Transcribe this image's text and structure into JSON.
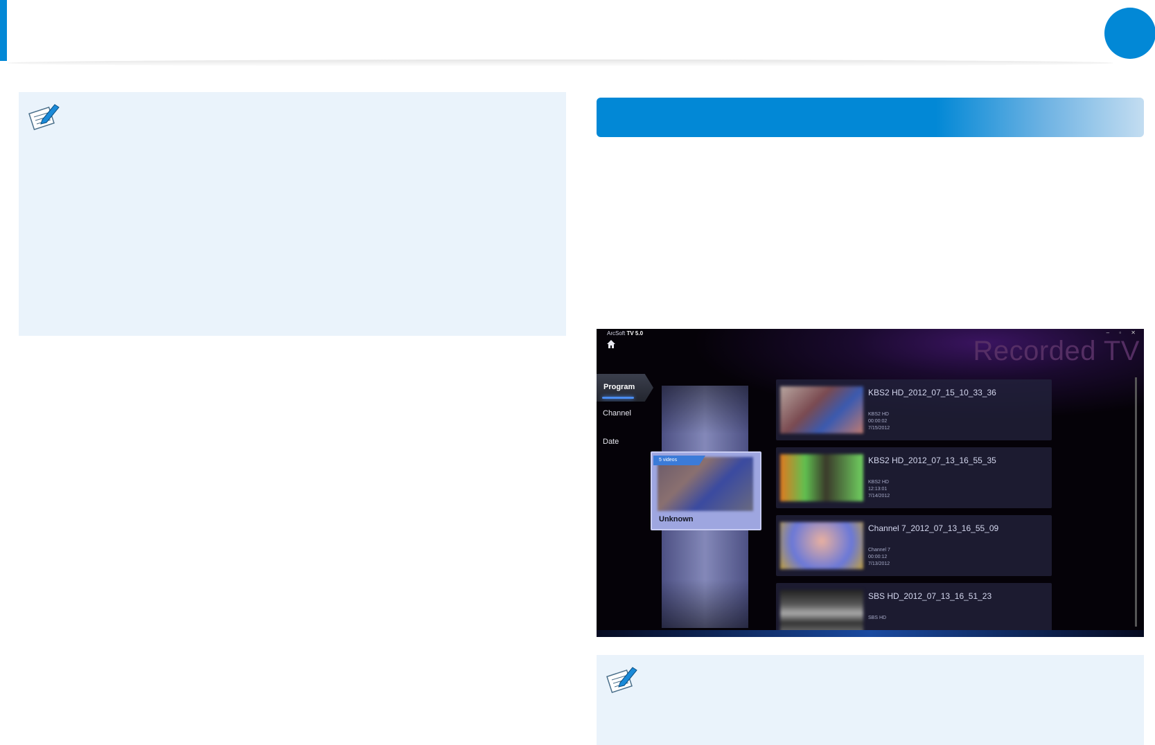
{
  "header": {
    "accent_color": "#0288d6",
    "chapter_marker_color": "#0288d6"
  },
  "left_note": {
    "icon": "note-pencil-icon",
    "background": "#eaf3fb"
  },
  "right_note": {
    "icon": "note-pencil-icon",
    "background": "#eaf3fb"
  },
  "section_bar": {
    "color": "#0288d6"
  },
  "app": {
    "title_prefix": "ArcSoft ",
    "title_bold": "TV 5.0",
    "window_controls": "– ▫ ✕",
    "screen_title": "Recorded TV",
    "nav": [
      {
        "label": "Program"
      },
      {
        "label": "Channel"
      },
      {
        "label": "Date"
      }
    ],
    "group_card": {
      "tag": "5 videos",
      "label": "Unknown"
    },
    "recordings": [
      {
        "title": "KBS2 HD_2012_07_15_10_33_36",
        "meta": "KBS2 HD\n00:00:02\n7/15/2012",
        "thumb_style": "linear-gradient(135deg,#b8a6a0,#7a4a50 40%,#3a5ab0 65%,#c07a70)"
      },
      {
        "title": "KBS2 HD_2012_07_13_16_55_35",
        "meta": "KBS2 HD\n12:13:01\n7/14/2012",
        "thumb_style": "linear-gradient(90deg,#e07a20,#60c050 30%,#3a3a2a 55%,#70d060)"
      },
      {
        "title": "Channel 7_2012_07_13_16_55_09",
        "meta": "Channel 7\n00:00:12\n7/13/2012",
        "thumb_style": "radial-gradient(circle at 50% 40%,#e8b0a0,#6a78d8 60%,#c0a040)"
      },
      {
        "title": "SBS HD_2012_07_13_16_51_23",
        "meta": "SBS HD",
        "thumb_style": "linear-gradient(180deg,#222 0%,#555 30%,#aaa 50%,#333 70%,#888 100%)"
      }
    ]
  }
}
